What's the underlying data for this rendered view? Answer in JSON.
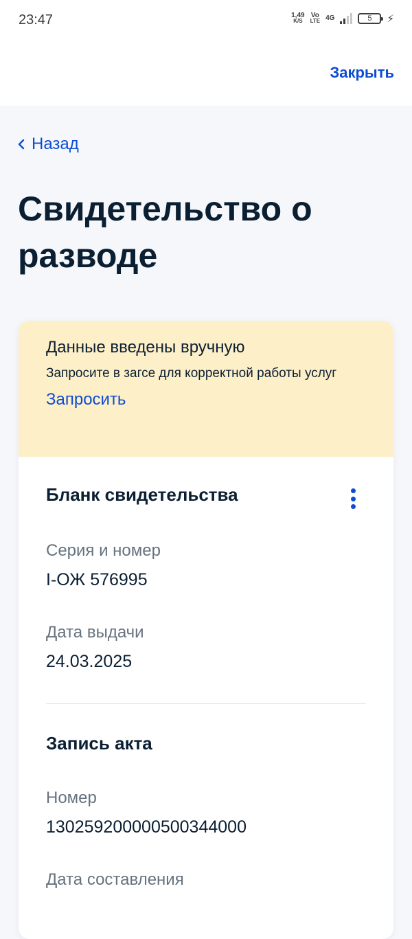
{
  "status_bar": {
    "time": "23:47",
    "net_speed_value": "1,49",
    "net_speed_unit": "K/S",
    "volte_top": "Vo",
    "volte_bottom": "LTE",
    "network_type": "4G",
    "battery_level": "5"
  },
  "header": {
    "close_label": "Закрыть",
    "back_label": "Назад",
    "page_title": "Свидетельство о разводе"
  },
  "notice": {
    "title": "Данные введены вручную",
    "text": "Запросите в загсе для корректной работы услуг",
    "link_label": "Запросить"
  },
  "certificate_blank": {
    "title": "Бланк свидетельства",
    "series_label": "Серия и номер",
    "series_value": "I-ОЖ 576995",
    "issue_date_label": "Дата выдачи",
    "issue_date_value": "24.03.2025"
  },
  "act_record": {
    "title": "Запись акта",
    "number_label": "Номер",
    "number_value": "130259200000500344000",
    "compiled_date_label": "Дата составления"
  },
  "colors": {
    "accent": "#0d4cd3",
    "notice_background": "#fdefc8",
    "page_background": "#f5f7fb",
    "text_primary": "#0b1f33",
    "text_secondary": "#66727f"
  }
}
